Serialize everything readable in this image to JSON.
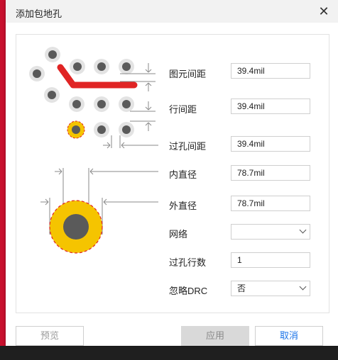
{
  "window": {
    "title": "添加包地孔",
    "close_glyph": "✕"
  },
  "labels": {
    "element_spacing": "图元间距",
    "row_spacing": "行间距",
    "via_spacing": "过孔间距",
    "inner_diameter": "内直径",
    "outer_diameter": "外直径",
    "net": "网络",
    "via_rows": "过孔行数",
    "ignore_drc": "忽略DRC"
  },
  "values": {
    "element_spacing": "39.4mil",
    "row_spacing": "39.4mil",
    "via_spacing": "39.4mil",
    "inner_diameter": "78.7mil",
    "outer_diameter": "78.7mil",
    "net": "",
    "via_rows": "1",
    "ignore_drc": "否"
  },
  "buttons": {
    "preview": "预览",
    "apply": "应用",
    "cancel": "取消"
  },
  "colors": {
    "via_gray": "#5a5a5a",
    "via_ring": "#e3e3e3",
    "track_red": "#e02424",
    "pad_yellow": "#f5c400",
    "link_blue": "#1a73e8"
  }
}
